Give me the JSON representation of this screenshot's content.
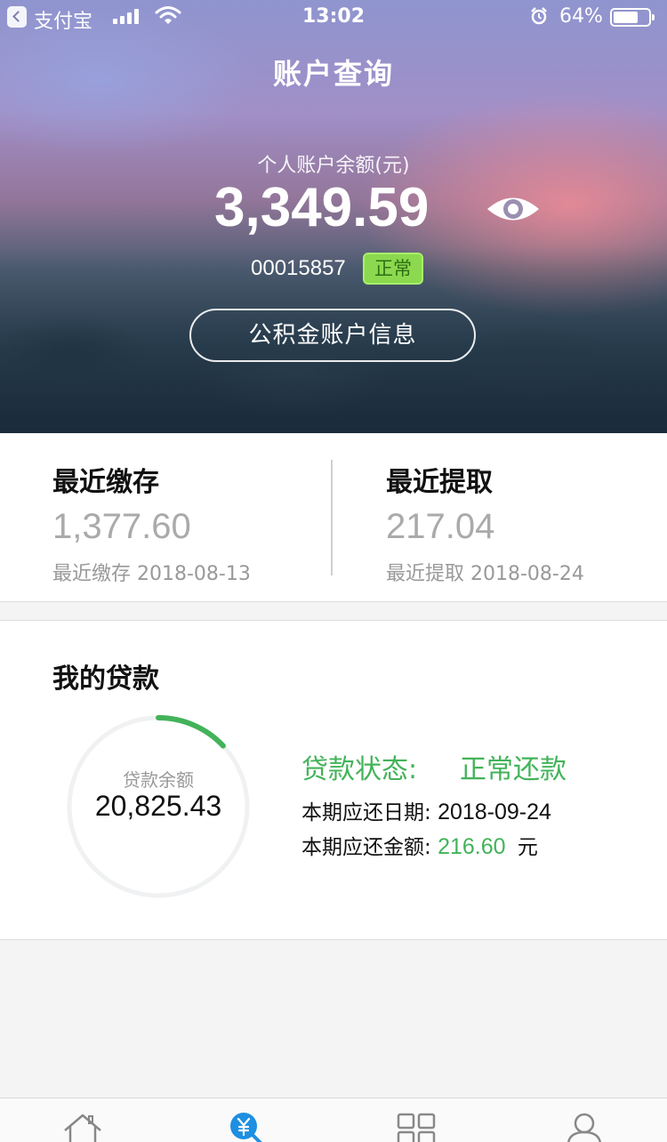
{
  "status_bar": {
    "app": "支付宝",
    "time": "13:02",
    "battery": "64%"
  },
  "header": {
    "title": "账户查询"
  },
  "account": {
    "balance_label": "个人账户余额(元)",
    "balance": "3,349.59",
    "account_number": "00015857",
    "status": "正常",
    "info_button": "公积金账户信息",
    "visibility_icon": "eye-icon"
  },
  "recent": {
    "deposit": {
      "title": "最近缴存",
      "amount": "1,377.60",
      "date_line": "最近缴存 2018-08-13"
    },
    "withdraw": {
      "title": "最近提取",
      "amount": "217.04",
      "date_line": "最近提取 2018-08-24"
    }
  },
  "loan": {
    "title": "我的贷款",
    "balance_label": "贷款余额",
    "balance": "20,825.43",
    "repaid_fraction": 0.13,
    "status_label": "贷款状态:",
    "status_value": "正常还款",
    "due_date_label": "本期应还日期:",
    "due_date": "2018-09-24",
    "due_amount_label": "本期应还金额:",
    "due_amount": "216.60",
    "due_amount_unit": "元"
  },
  "tabbar": {
    "items": [
      {
        "icon": "home-icon",
        "active": false
      },
      {
        "icon": "yuan-search-icon",
        "active": true
      },
      {
        "icon": "grid-icon",
        "active": false
      },
      {
        "icon": "person-icon",
        "active": false
      }
    ]
  },
  "colors": {
    "accent_green": "#43b35a",
    "badge_green": "#8cd94f",
    "tab_active_blue": "#1e8fe1"
  }
}
